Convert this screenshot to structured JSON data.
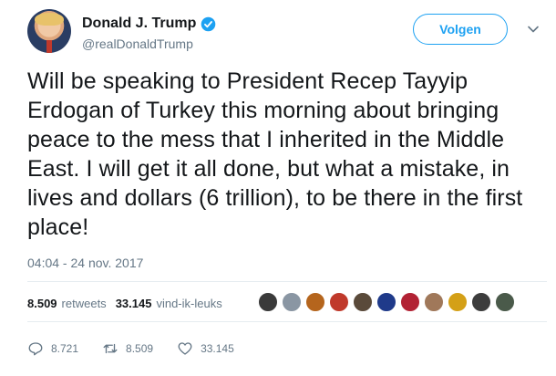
{
  "author": {
    "name": "Donald J. Trump",
    "handle": "@realDonaldTrump"
  },
  "follow_label": "Volgen",
  "tweet_text": "Will be speaking to President Recep Tayyip Erdogan of Turkey this morning about bringing peace to the mess that I inherited in the Middle East. I will get it all done, but what a mistake, in lives and dollars (6 trillion), to be there in the first place!",
  "timestamp": "04:04 - 24 nov. 2017",
  "stats": {
    "retweets_count": "8.509",
    "retweets_label": "retweets",
    "likes_count": "33.145",
    "likes_label": "vind-ik-leuks"
  },
  "liker_avatars": [
    {
      "color": "#3a3a3a"
    },
    {
      "color": "#8a96a3"
    },
    {
      "color": "#b5651d"
    },
    {
      "color": "#c0392b"
    },
    {
      "color": "#5a4a3a"
    },
    {
      "color": "#1f3a8a"
    },
    {
      "color": "#b22234"
    },
    {
      "color": "#a0785a"
    },
    {
      "color": "#d4a017"
    },
    {
      "color": "#3d3d3d"
    },
    {
      "color": "#4a5a4a"
    }
  ],
  "actions": {
    "replies": "8.721",
    "retweets": "8.509",
    "likes": "33.145"
  },
  "colors": {
    "accent": "#1da1f2",
    "muted": "#657786",
    "text": "#14171a"
  }
}
